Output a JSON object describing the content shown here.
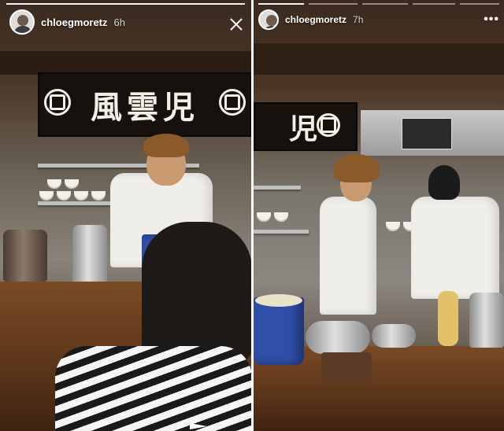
{
  "stories": [
    {
      "username": "chloegmoretz",
      "time": "6h",
      "sign_text": "風雲児",
      "icons": {
        "avatar": "avatar-icon",
        "close": "close-icon",
        "send": "send-icon"
      }
    },
    {
      "username": "chloegmoretz",
      "time": "7h",
      "sign_text": "児",
      "icons": {
        "avatar": "avatar-icon",
        "more": "more-options-icon"
      }
    }
  ],
  "ui": {
    "more_label": "•••"
  }
}
